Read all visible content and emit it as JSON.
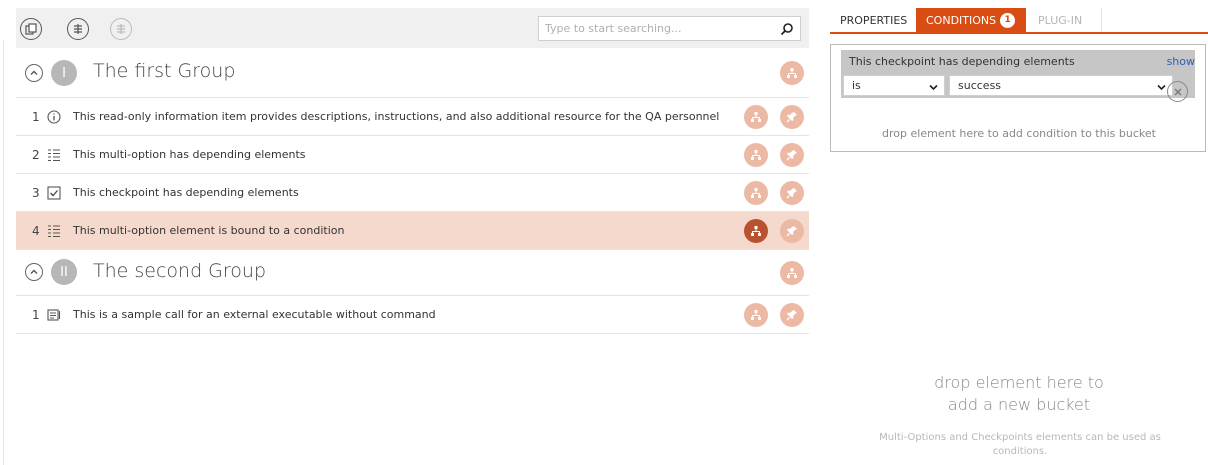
{
  "toolbar": {
    "buttons": [
      "copy-icon",
      "add-item-icon",
      "add-subitem-icon"
    ],
    "search": {
      "placeholder": "Type to start searching...",
      "value": ""
    }
  },
  "groups": [
    {
      "numeral": "I",
      "title": "The first Group",
      "items": [
        {
          "num": "1",
          "icon": "info-icon",
          "text": "This read-only information item provides descriptions, instructions, and also additional resource for the QA personnel"
        },
        {
          "num": "2",
          "icon": "multi-option-icon",
          "text": "This multi-option has depending elements"
        },
        {
          "num": "3",
          "icon": "checkbox-icon",
          "text": "This checkpoint has depending elements"
        },
        {
          "num": "4",
          "icon": "multi-option-icon",
          "text": "This multi-option element is bound to a condition",
          "selected": true
        }
      ]
    },
    {
      "numeral": "II",
      "title": "The second Group",
      "items": [
        {
          "num": "1",
          "icon": "executable-icon",
          "text": "This is a sample call for an external executable without command"
        }
      ]
    }
  ],
  "panel": {
    "tabs": {
      "properties": "PROPERTIES",
      "conditions": "CONDITIONS",
      "conditions_badge": "1",
      "plugin": "PLUG-IN"
    },
    "bucket": {
      "title": "This checkpoint has depending elements",
      "show": "show",
      "operator": "is",
      "value": "success",
      "drop_hint": "drop element here to add condition to this bucket"
    },
    "drop_bucket_line1": "drop element here to",
    "drop_bucket_line2": "add a new bucket",
    "hint": "Multi-Options and Checkpoints elements can be used as conditions."
  },
  "colors": {
    "accent": "#d94d15",
    "selected_row": "#f6d9cd",
    "action_light": "#ecb9a4",
    "action_active": "#b9532f"
  }
}
